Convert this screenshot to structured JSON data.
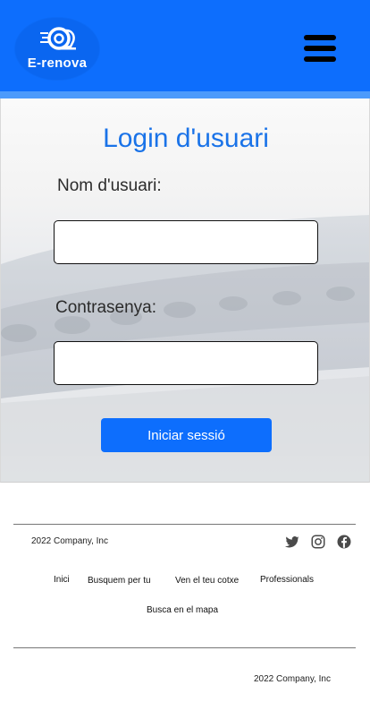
{
  "header": {
    "logo_text": "E-renova",
    "menu_icon": "hamburger-menu-icon",
    "brand_color": "#0d6efd"
  },
  "login": {
    "title": "Login d'usuari",
    "username_label": "Nom d'usuari:",
    "username_value": "",
    "password_label": "Contrasenya:",
    "password_value": "",
    "submit_label": "Iniciar sessió"
  },
  "footer": {
    "copyright_top": "2022 Company, Inc",
    "social_icons": [
      "twitter-icon",
      "instagram-icon",
      "facebook-icon"
    ],
    "nav": {
      "inici": "Inici",
      "busquem": "Busquem per tu",
      "ven": "Ven el teu cotxe",
      "professionals": "Professionals",
      "mapa": "Busca en el mapa"
    },
    "copyright_bottom": "2022 Company, Inc"
  }
}
